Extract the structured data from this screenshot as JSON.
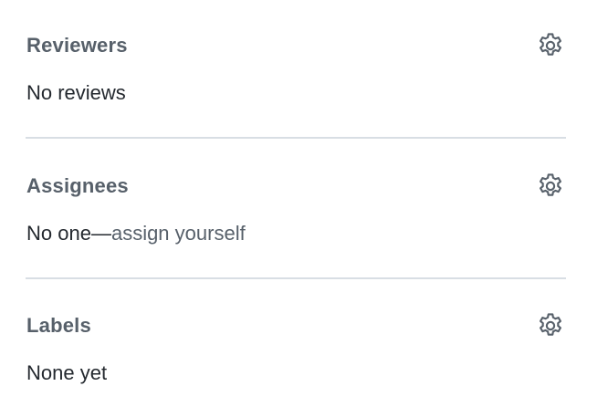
{
  "sections": [
    {
      "title": "Reviewers",
      "body": "No reviews",
      "settings_icon": "gear-icon"
    },
    {
      "title": "Assignees",
      "body_prefix": "No one—",
      "body_link": "assign yourself",
      "settings_icon": "gear-icon"
    },
    {
      "title": "Labels",
      "body": "None yet",
      "settings_icon": "gear-icon"
    }
  ],
  "colors": {
    "heading": "#57606a",
    "text": "#24292f",
    "divider": "#d8dee4"
  }
}
